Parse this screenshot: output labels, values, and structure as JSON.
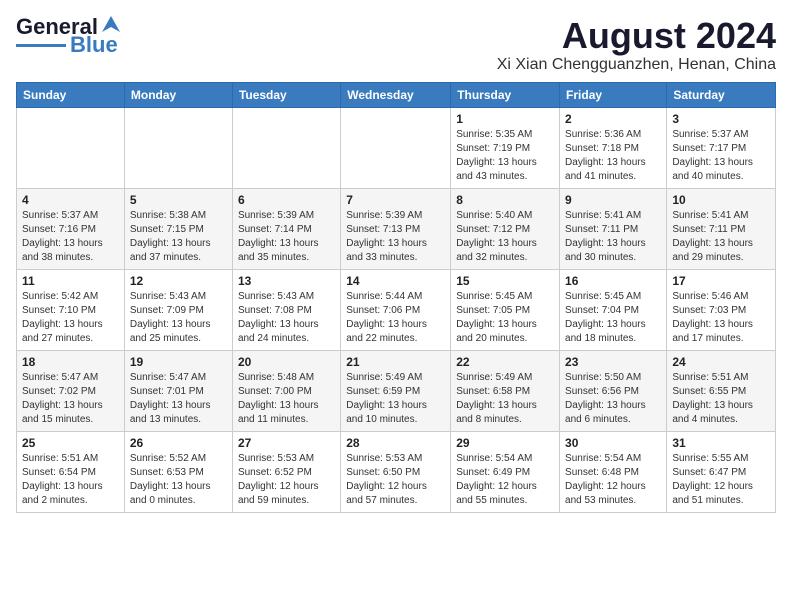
{
  "logo": {
    "line1": "General",
    "line2": "Blue"
  },
  "title": "August 2024",
  "subtitle": "Xi Xian Chengguanzhen, Henan, China",
  "weekdays": [
    "Sunday",
    "Monday",
    "Tuesday",
    "Wednesday",
    "Thursday",
    "Friday",
    "Saturday"
  ],
  "weeks": [
    [
      {
        "day": "",
        "info": ""
      },
      {
        "day": "",
        "info": ""
      },
      {
        "day": "",
        "info": ""
      },
      {
        "day": "",
        "info": ""
      },
      {
        "day": "1",
        "info": "Sunrise: 5:35 AM\nSunset: 7:19 PM\nDaylight: 13 hours\nand 43 minutes."
      },
      {
        "day": "2",
        "info": "Sunrise: 5:36 AM\nSunset: 7:18 PM\nDaylight: 13 hours\nand 41 minutes."
      },
      {
        "day": "3",
        "info": "Sunrise: 5:37 AM\nSunset: 7:17 PM\nDaylight: 13 hours\nand 40 minutes."
      }
    ],
    [
      {
        "day": "4",
        "info": "Sunrise: 5:37 AM\nSunset: 7:16 PM\nDaylight: 13 hours\nand 38 minutes."
      },
      {
        "day": "5",
        "info": "Sunrise: 5:38 AM\nSunset: 7:15 PM\nDaylight: 13 hours\nand 37 minutes."
      },
      {
        "day": "6",
        "info": "Sunrise: 5:39 AM\nSunset: 7:14 PM\nDaylight: 13 hours\nand 35 minutes."
      },
      {
        "day": "7",
        "info": "Sunrise: 5:39 AM\nSunset: 7:13 PM\nDaylight: 13 hours\nand 33 minutes."
      },
      {
        "day": "8",
        "info": "Sunrise: 5:40 AM\nSunset: 7:12 PM\nDaylight: 13 hours\nand 32 minutes."
      },
      {
        "day": "9",
        "info": "Sunrise: 5:41 AM\nSunset: 7:11 PM\nDaylight: 13 hours\nand 30 minutes."
      },
      {
        "day": "10",
        "info": "Sunrise: 5:41 AM\nSunset: 7:11 PM\nDaylight: 13 hours\nand 29 minutes."
      }
    ],
    [
      {
        "day": "11",
        "info": "Sunrise: 5:42 AM\nSunset: 7:10 PM\nDaylight: 13 hours\nand 27 minutes."
      },
      {
        "day": "12",
        "info": "Sunrise: 5:43 AM\nSunset: 7:09 PM\nDaylight: 13 hours\nand 25 minutes."
      },
      {
        "day": "13",
        "info": "Sunrise: 5:43 AM\nSunset: 7:08 PM\nDaylight: 13 hours\nand 24 minutes."
      },
      {
        "day": "14",
        "info": "Sunrise: 5:44 AM\nSunset: 7:06 PM\nDaylight: 13 hours\nand 22 minutes."
      },
      {
        "day": "15",
        "info": "Sunrise: 5:45 AM\nSunset: 7:05 PM\nDaylight: 13 hours\nand 20 minutes."
      },
      {
        "day": "16",
        "info": "Sunrise: 5:45 AM\nSunset: 7:04 PM\nDaylight: 13 hours\nand 18 minutes."
      },
      {
        "day": "17",
        "info": "Sunrise: 5:46 AM\nSunset: 7:03 PM\nDaylight: 13 hours\nand 17 minutes."
      }
    ],
    [
      {
        "day": "18",
        "info": "Sunrise: 5:47 AM\nSunset: 7:02 PM\nDaylight: 13 hours\nand 15 minutes."
      },
      {
        "day": "19",
        "info": "Sunrise: 5:47 AM\nSunset: 7:01 PM\nDaylight: 13 hours\nand 13 minutes."
      },
      {
        "day": "20",
        "info": "Sunrise: 5:48 AM\nSunset: 7:00 PM\nDaylight: 13 hours\nand 11 minutes."
      },
      {
        "day": "21",
        "info": "Sunrise: 5:49 AM\nSunset: 6:59 PM\nDaylight: 13 hours\nand 10 minutes."
      },
      {
        "day": "22",
        "info": "Sunrise: 5:49 AM\nSunset: 6:58 PM\nDaylight: 13 hours\nand 8 minutes."
      },
      {
        "day": "23",
        "info": "Sunrise: 5:50 AM\nSunset: 6:56 PM\nDaylight: 13 hours\nand 6 minutes."
      },
      {
        "day": "24",
        "info": "Sunrise: 5:51 AM\nSunset: 6:55 PM\nDaylight: 13 hours\nand 4 minutes."
      }
    ],
    [
      {
        "day": "25",
        "info": "Sunrise: 5:51 AM\nSunset: 6:54 PM\nDaylight: 13 hours\nand 2 minutes."
      },
      {
        "day": "26",
        "info": "Sunrise: 5:52 AM\nSunset: 6:53 PM\nDaylight: 13 hours\nand 0 minutes."
      },
      {
        "day": "27",
        "info": "Sunrise: 5:53 AM\nSunset: 6:52 PM\nDaylight: 12 hours\nand 59 minutes."
      },
      {
        "day": "28",
        "info": "Sunrise: 5:53 AM\nSunset: 6:50 PM\nDaylight: 12 hours\nand 57 minutes."
      },
      {
        "day": "29",
        "info": "Sunrise: 5:54 AM\nSunset: 6:49 PM\nDaylight: 12 hours\nand 55 minutes."
      },
      {
        "day": "30",
        "info": "Sunrise: 5:54 AM\nSunset: 6:48 PM\nDaylight: 12 hours\nand 53 minutes."
      },
      {
        "day": "31",
        "info": "Sunrise: 5:55 AM\nSunset: 6:47 PM\nDaylight: 12 hours\nand 51 minutes."
      }
    ]
  ]
}
